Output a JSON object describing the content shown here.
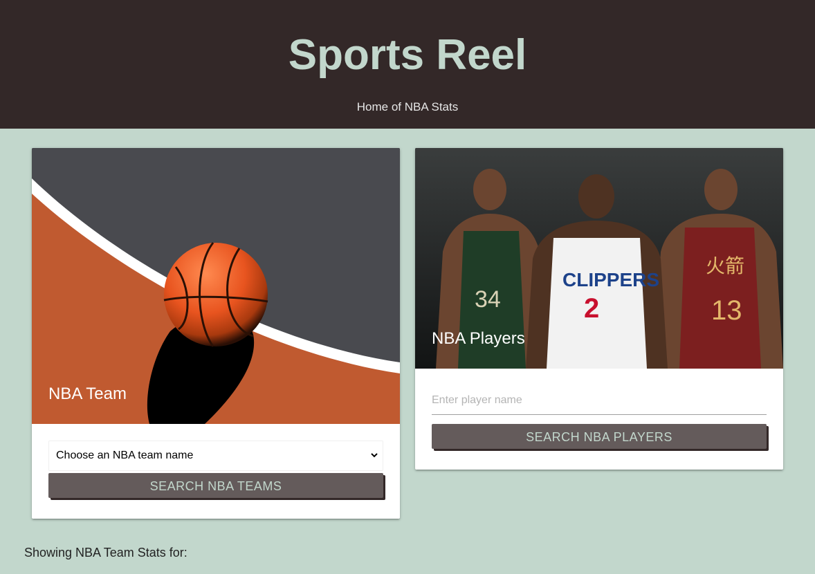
{
  "header": {
    "title": "Sports Reel",
    "subtitle": "Home of NBA Stats"
  },
  "team_card": {
    "title": "NBA Team",
    "select": {
      "selected": "Choose an NBA team name"
    },
    "button_label": "SEARCH NBA TEAMS"
  },
  "player_card": {
    "title": "NBA Players",
    "input": {
      "placeholder": "Enter player name",
      "value": ""
    },
    "button_label": "SEARCH NBA PLAYERS",
    "jersey_labels": [
      "CLIPPERS",
      "2",
      "34",
      "13",
      "火箭"
    ]
  },
  "status": {
    "text": "Showing NBA Team Stats for:"
  },
  "colors": {
    "header_bg": "#332828",
    "page_bg": "#c2d7cc",
    "button_bg": "#645b5b",
    "button_text": "#c2d7cc",
    "court_orange": "#c05a30"
  }
}
